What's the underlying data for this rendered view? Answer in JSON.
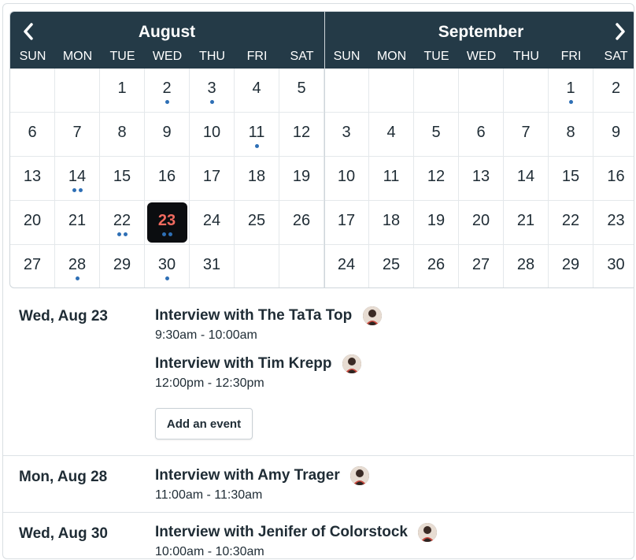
{
  "calendar": {
    "months": [
      {
        "name": "August",
        "weekdays": [
          "SUN",
          "MON",
          "TUE",
          "WED",
          "THU",
          "FRI",
          "SAT"
        ],
        "weeks": [
          [
            "",
            "",
            "1",
            "2",
            "3",
            "4",
            "5"
          ],
          [
            "6",
            "7",
            "8",
            "9",
            "10",
            "11",
            "12"
          ],
          [
            "13",
            "14",
            "15",
            "16",
            "17",
            "18",
            "19"
          ],
          [
            "20",
            "21",
            "22",
            "23",
            "24",
            "25",
            "26"
          ],
          [
            "27",
            "28",
            "29",
            "30",
            "31",
            "",
            ""
          ]
        ],
        "dots": {
          "2": 1,
          "3": 1,
          "11": 1,
          "14": 2,
          "22": 2,
          "23": 2,
          "28": 1,
          "30": 1
        },
        "selected": "23"
      },
      {
        "name": "September",
        "weekdays": [
          "SUN",
          "MON",
          "TUE",
          "WED",
          "THU",
          "FRI",
          "SAT"
        ],
        "weeks": [
          [
            "",
            "",
            "",
            "",
            "",
            "1",
            "2"
          ],
          [
            "3",
            "4",
            "5",
            "6",
            "7",
            "8",
            "9"
          ],
          [
            "10",
            "11",
            "12",
            "13",
            "14",
            "15",
            "16"
          ],
          [
            "17",
            "18",
            "19",
            "20",
            "21",
            "22",
            "23"
          ],
          [
            "24",
            "25",
            "26",
            "27",
            "28",
            "29",
            "30"
          ]
        ],
        "dots": {
          "1": 1
        },
        "selected": ""
      }
    ],
    "prev_icon": "chevron-left-icon",
    "next_icon": "chevron-right-icon",
    "colors": {
      "header": "#243a47",
      "dot": "#2e6fb5",
      "selected_bg": "#0b0d10",
      "selected_text": "#f06a5f"
    }
  },
  "agenda": {
    "days": [
      {
        "label": "Wed, Aug 23",
        "events": [
          {
            "title": "Interview with The TaTa Top",
            "time": "9:30am - 10:00am"
          },
          {
            "title": "Interview with Tim Krepp",
            "time": "12:00pm - 12:30pm"
          }
        ],
        "add_label": "Add an event"
      },
      {
        "label": "Mon, Aug 28",
        "events": [
          {
            "title": "Interview with Amy Trager",
            "time": "11:00am - 11:30am"
          }
        ]
      },
      {
        "label": "Wed, Aug 30",
        "events": [
          {
            "title": "Interview with Jenifer of Colorstock",
            "time": "10:00am - 10:30am"
          }
        ]
      }
    ]
  }
}
